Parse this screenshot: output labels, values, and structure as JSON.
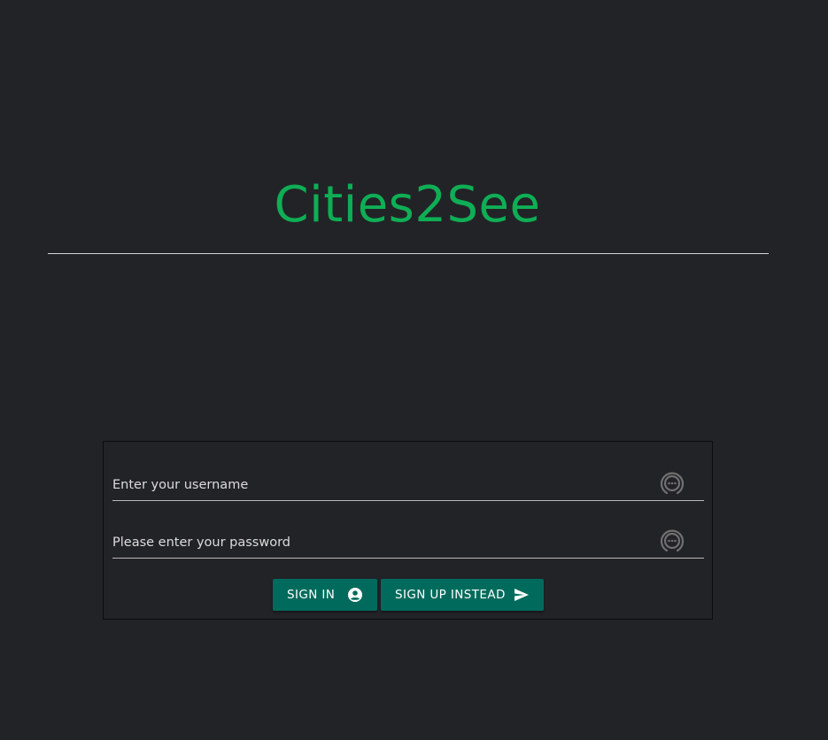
{
  "app": {
    "title": "Cities2See"
  },
  "login": {
    "username_placeholder": "Enter your username",
    "username_value": "",
    "password_placeholder": "Please enter your password",
    "password_value": "",
    "signin_label": "SIGN IN",
    "signup_label": "SIGN UP INSTEAD",
    "field_icon": "chat-bubble-icon",
    "signin_icon": "account-circle-icon",
    "signup_icon": "send-icon"
  },
  "colors": {
    "background": "#222327",
    "title": "#0fae55",
    "button": "#006b5c",
    "divider": "#d5d5d5"
  }
}
